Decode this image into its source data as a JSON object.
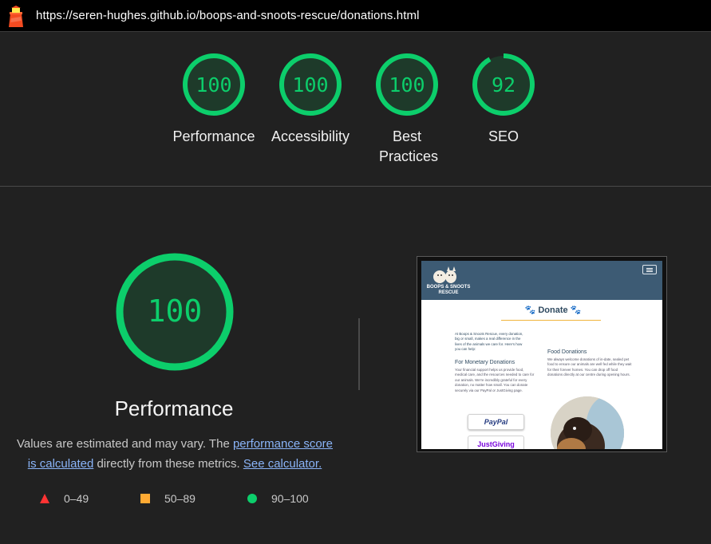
{
  "header": {
    "url": "https://seren-hughes.github.io/boops-and-snoots-rescue/donations.html",
    "logo_icon": "lighthouse-icon"
  },
  "scores": [
    {
      "label": "Performance",
      "value": "100",
      "fraction": 1.0
    },
    {
      "label": "Accessibility",
      "value": "100",
      "fraction": 1.0
    },
    {
      "label": "Best Practices",
      "value": "100",
      "fraction": 1.0
    },
    {
      "label": "SEO",
      "value": "92",
      "fraction": 0.92
    }
  ],
  "performance": {
    "score": "100",
    "title": "Performance",
    "desc_prefix": "Values are estimated and may vary. The ",
    "desc_link": "performance score is calculated",
    "desc_middle": " directly from these metrics. ",
    "desc_link2": "See calculator."
  },
  "legend": [
    {
      "range": "0–49",
      "shape": "triangle",
      "color": "#ff3333"
    },
    {
      "range": "50–89",
      "shape": "square",
      "color": "#ffaa33"
    },
    {
      "range": "90–100",
      "shape": "circle",
      "color": "#0cce6b"
    }
  ],
  "colors": {
    "pass": "#0cce6b",
    "gauge_fill": "#1e3a2a",
    "background": "#212121"
  },
  "screenshot": {
    "brand": "BOOPS & SNOOTS RESCUE",
    "title": "🐾 Donate 🐾",
    "intro": "At Boops & Snoots Rescue, every donation, big or small, makes a real difference in the lives of the animals we care for. Here's how you can help:",
    "monetary_heading": "For Monetary Donations",
    "monetary_text": "Your financial support helps us provide food, medical care, and the resources needed to care for our animals. We're incredibly grateful for every donation, no matter how small. You can donate securely via our PayPal or JustGiving page.",
    "food_heading": "Food Donations",
    "food_text": "We always welcome donations of in-date, sealed pet food to ensure our animals are well fed while they wait for their forever homes. You can drop off food donations directly at our centre during opening hours.",
    "paypal_label": "PayPal",
    "justgiving_label": "JustGiving"
  }
}
